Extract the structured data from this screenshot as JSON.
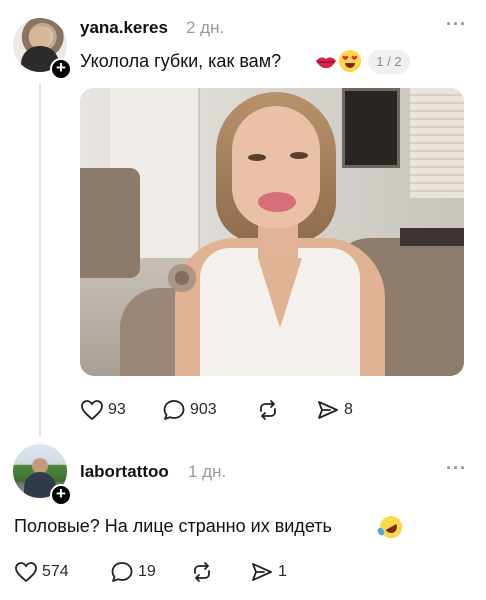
{
  "post": {
    "author": {
      "username": "yana.keres",
      "time": "2 дн."
    },
    "text": "Уколола губки, как вам?",
    "emojis": [
      "kiss-lips",
      "heart-eyes-face"
    ],
    "media_counter": "1 / 2",
    "stats": {
      "likes": "93",
      "comments": "903",
      "reposts": "",
      "shares": "8"
    }
  },
  "reply": {
    "author": {
      "username": "labortattoo",
      "time": "1 дн."
    },
    "text": "Половые? На лице странно их видеть",
    "emojis": [
      "rolling-on-floor-laughing-face"
    ],
    "stats": {
      "likes": "574",
      "comments": "19",
      "reposts": "",
      "shares": "1"
    }
  },
  "colors": {
    "text": "#111111",
    "muted": "#9a9a9a",
    "thread_line": "#e3e3e3",
    "pill_bg": "#f0f0f0"
  },
  "icons": {
    "like": "heart-icon",
    "comment": "comment-bubble-icon",
    "repost": "repost-arrows-icon",
    "share": "send-arrow-icon",
    "more": "more-dots-icon",
    "follow": "plus-icon"
  }
}
